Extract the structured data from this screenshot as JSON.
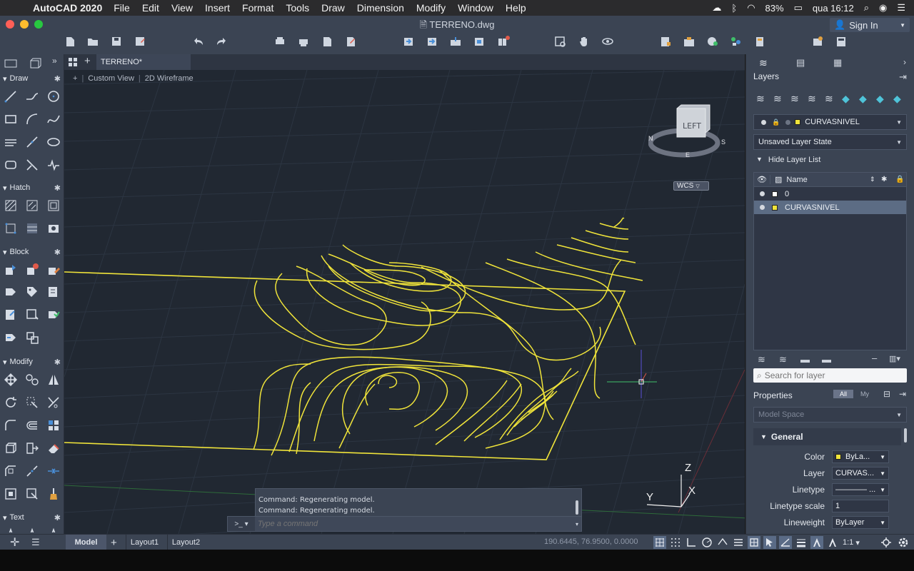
{
  "menubar": {
    "app_name": "AutoCAD 2020",
    "menus": [
      "File",
      "Edit",
      "View",
      "Insert",
      "Format",
      "Tools",
      "Draw",
      "Dimension",
      "Modify",
      "Window",
      "Help"
    ],
    "battery": "83%",
    "clock": "qua 16:12"
  },
  "window": {
    "title": "TERRENO.dwg",
    "sign_in": "Sign In"
  },
  "tabs": {
    "document_tab": "TERRENO*"
  },
  "viewport": {
    "view_name": "Custom View",
    "visual_style": "2D Wireframe",
    "viewcube_face": "LEFT",
    "ucs_label": "WCS",
    "axis_x": "X",
    "axis_y": "Y",
    "axis_z": "Z"
  },
  "palette": {
    "sections": [
      "Draw",
      "Hatch",
      "Block",
      "Modify",
      "Text"
    ]
  },
  "command": {
    "history": [
      "Command:  Regenerating model.",
      "Command:  Regenerating model."
    ],
    "prompt": ">_",
    "placeholder": "Type a command"
  },
  "status": {
    "tabs": [
      "Model",
      "Layout1",
      "Layout2"
    ],
    "coordinates": "190.6445, 76.9500, 0.0000",
    "scale": "1:1"
  },
  "layers": {
    "title": "Layers",
    "current_layer": "CURVASNIVEL",
    "layer_state": "Unsaved Layer State",
    "hide_list": "Hide Layer List",
    "column_name": "Name",
    "rows": [
      {
        "name": "0",
        "color": "#ffffff"
      },
      {
        "name": "CURVASNIVEL",
        "color": "#f0e43a"
      }
    ],
    "search_placeholder": "Search for layer"
  },
  "properties": {
    "title": "Properties",
    "toggle_all": "All",
    "toggle_my": "My",
    "space": "Model Space",
    "section": "General",
    "rows": [
      {
        "label": "Color",
        "value": "ByLa..."
      },
      {
        "label": "Layer",
        "value": "CURVAS..."
      },
      {
        "label": "Linetype",
        "value": "———— ..."
      },
      {
        "label": "Linetype scale",
        "value": "1"
      },
      {
        "label": "Lineweight",
        "value": "ByLayer"
      }
    ]
  },
  "colors": {
    "contour": "#f0e43a",
    "panel": "#3b4453",
    "canvas": "#212832",
    "grid": "#2c3542"
  }
}
